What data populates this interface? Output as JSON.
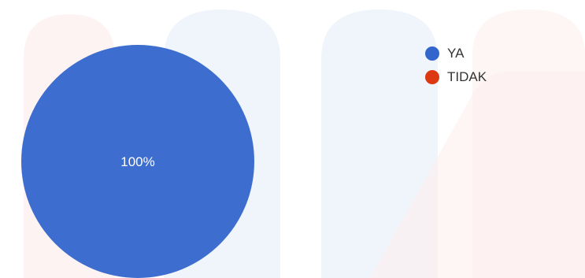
{
  "chart_data": {
    "type": "pie",
    "slices": [
      {
        "label": "YA",
        "value": 100,
        "color": "#3366cc"
      },
      {
        "label": "TIDAK",
        "value": 0,
        "color": "#dc3912"
      }
    ],
    "data_labels": [
      "100%"
    ],
    "legend_position": "top-right"
  },
  "legend": {
    "items": [
      {
        "label": "YA",
        "color": "#3366cc",
        "icon": "circle-swatch"
      },
      {
        "label": "TIDAK",
        "color": "#dc3912",
        "icon": "circle-swatch"
      }
    ]
  }
}
